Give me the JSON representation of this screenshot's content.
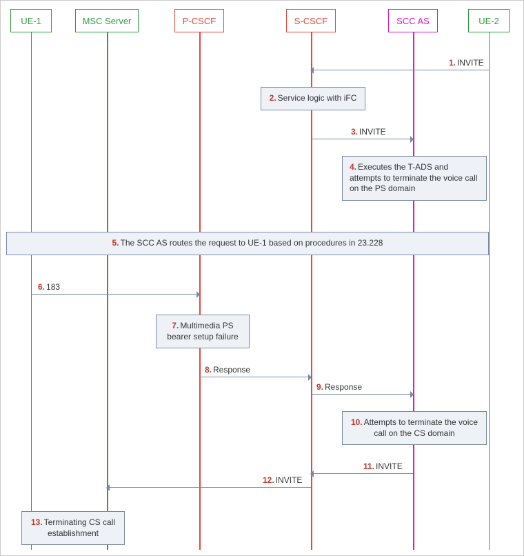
{
  "actors": {
    "ue1": "UE-1",
    "msc": "MSC Server",
    "pcscf": "P-CSCF",
    "scscf": "S-CSCF",
    "sccas": "SCC AS",
    "ue2": "UE-2"
  },
  "steps": {
    "s1": {
      "n": "1.",
      "t": "INVITE"
    },
    "s2": {
      "n": "2.",
      "t": "Service logic with iFC"
    },
    "s3": {
      "n": "3.",
      "t": "INVITE"
    },
    "s4": {
      "n": "4.",
      "t": "Executes the T-ADS and attempts to terminate the voice call on the PS domain"
    },
    "s5": {
      "n": "5.",
      "t": "The SCC AS routes the request to UE-1 based on procedures in 23.228"
    },
    "s6": {
      "n": "6.",
      "t": "183"
    },
    "s7": {
      "n": "7.",
      "t": "Multimedia PS bearer setup failure"
    },
    "s8": {
      "n": "8.",
      "t": "Response"
    },
    "s9": {
      "n": "9.",
      "t": "Response"
    },
    "s10": {
      "n": "10.",
      "t": "Attempts to terminate the voice call on the CS domain"
    },
    "s11": {
      "n": "11.",
      "t": "INVITE"
    },
    "s12": {
      "n": "12.",
      "t": "INVITE"
    },
    "s13": {
      "n": "13.",
      "t": "Terminating CS call establishment"
    }
  }
}
